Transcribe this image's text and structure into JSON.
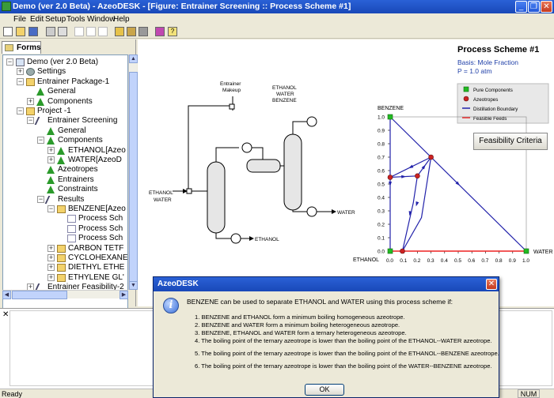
{
  "window": {
    "title": "Demo (ver 2.0 Beta) - AzeoDESK - [Figure: Entrainer Screening :: Process Scheme #1]",
    "minimize": "_",
    "restore": "❐",
    "close": "✕"
  },
  "menu": [
    "File",
    "Edit",
    "Setup",
    "Tools",
    "Window",
    "Help"
  ],
  "left_pane": {
    "tab_label": "Forms",
    "tree": [
      {
        "label": "Demo (ver 2.0 Beta)",
        "icon": "project-icon",
        "level": 0,
        "expander": "−"
      },
      {
        "label": "Settings",
        "icon": "settings-icon",
        "level": 1,
        "expander": "+"
      },
      {
        "label": "Entrainer Package-1",
        "icon": "folder-icon",
        "level": 1,
        "expander": "−"
      },
      {
        "label": "General",
        "icon": "triangle-icon",
        "level": 2,
        "expander": ""
      },
      {
        "label": "Components",
        "icon": "triangle-icon",
        "level": 2,
        "expander": "+"
      },
      {
        "label": "Project -1",
        "icon": "folder-icon",
        "level": 1,
        "expander": "−"
      },
      {
        "label": "Entrainer Screening",
        "icon": "screening-icon",
        "level": 2,
        "expander": "−"
      },
      {
        "label": "General",
        "icon": "triangle-icon",
        "level": 3,
        "expander": ""
      },
      {
        "label": "Components",
        "icon": "triangle-icon",
        "level": 3,
        "expander": "−"
      },
      {
        "label": "ETHANOL[Azeo",
        "icon": "triangle-icon",
        "level": 4,
        "expander": "+"
      },
      {
        "label": "WATER[AzeoD",
        "icon": "triangle-icon",
        "level": 4,
        "expander": "+"
      },
      {
        "label": "Azeotropes",
        "icon": "triangle-icon",
        "level": 3,
        "expander": ""
      },
      {
        "label": "Entrainers",
        "icon": "triangle-icon",
        "level": 3,
        "expander": ""
      },
      {
        "label": "Constraints",
        "icon": "triangle-icon",
        "level": 3,
        "expander": ""
      },
      {
        "label": "Results",
        "icon": "screening-icon",
        "level": 3,
        "expander": "−"
      },
      {
        "label": "BENZENE[Azeo",
        "icon": "folder-icon",
        "level": 4,
        "expander": "−"
      },
      {
        "label": "Process Sch",
        "icon": "document-icon",
        "level": 5,
        "expander": ""
      },
      {
        "label": "Process Sch",
        "icon": "document-icon",
        "level": 5,
        "expander": ""
      },
      {
        "label": "Process Sch",
        "icon": "document-icon",
        "level": 5,
        "expander": ""
      },
      {
        "label": "CARBON TETF",
        "icon": "folder-icon",
        "level": 4,
        "expander": "+"
      },
      {
        "label": "CYCLOHEXANE",
        "icon": "folder-icon",
        "level": 4,
        "expander": "+"
      },
      {
        "label": "DIETHYL ETHE",
        "icon": "folder-icon",
        "level": 4,
        "expander": "+"
      },
      {
        "label": "ETHYLENE GL'",
        "icon": "folder-icon",
        "level": 4,
        "expander": "+"
      },
      {
        "label": "Entrainer Feasibility-2",
        "icon": "screening-icon",
        "level": 2,
        "expander": "+"
      }
    ]
  },
  "scheme": {
    "title": "Process Scheme #1",
    "basis": "Basis: Mole Fraction",
    "pressure": "P = 1.0 atm",
    "makeup_label_1": "Entrainer",
    "makeup_label_2": "Makeup",
    "top_label_1": "ETHANOL",
    "top_label_2": "WATER",
    "top_label_3": "BENZENE",
    "feed_label_1": "ETHANOL",
    "feed_label_2": "WATER",
    "water_out": "WATER",
    "ethanol_out": "ETHANOL",
    "feasibility_button": "Feasibility Criteria"
  },
  "legend": {
    "items": [
      {
        "label": "Pure Components",
        "color": "#22bb22"
      },
      {
        "label": "Azeotropes",
        "color": "#cc2222"
      },
      {
        "label": "Distillation Boundary",
        "color": "#2222aa"
      },
      {
        "label": "Feasible Feeds",
        "color": "#ee2222"
      }
    ]
  },
  "chart_data": {
    "type": "line",
    "subtype": "ternary-residue-curve-map",
    "corners": {
      "top": "BENZENE",
      "left": "ETHANOL",
      "right": "WATER"
    },
    "x_ticks": [
      "0.0",
      "0.1",
      "0.2",
      "0.3",
      "0.4",
      "0.5",
      "0.6",
      "0.7",
      "0.8",
      "0.9",
      "1.0"
    ],
    "y_ticks": [
      "0.0",
      "0.1",
      "0.2",
      "0.3",
      "0.4",
      "0.5",
      "0.6",
      "0.7",
      "0.8",
      "0.9",
      "1.0"
    ],
    "xlim": [
      0,
      1
    ],
    "ylim": [
      0,
      1
    ],
    "pure_components": [
      {
        "x": 0.0,
        "y": 1.0
      },
      {
        "x": 0.0,
        "y": 0.0
      },
      {
        "x": 1.0,
        "y": 0.0
      }
    ],
    "azeotropes": [
      {
        "x": 0.0,
        "y": 0.55
      },
      {
        "x": 0.09,
        "y": 0.0
      },
      {
        "x": 0.2,
        "y": 0.56
      },
      {
        "x": 0.3,
        "y": 0.7
      }
    ],
    "boundaries": [
      [
        {
          "x": 0.0,
          "y": 1.0
        },
        {
          "x": 1.0,
          "y": 0.0
        }
      ],
      [
        {
          "x": 0.0,
          "y": 1.0
        },
        {
          "x": 0.0,
          "y": 0.0
        }
      ],
      [
        {
          "x": 0.0,
          "y": 0.55
        },
        {
          "x": 0.2,
          "y": 0.56
        }
      ],
      [
        {
          "x": 0.2,
          "y": 0.56
        },
        {
          "x": 0.3,
          "y": 0.7
        }
      ],
      [
        {
          "x": 0.3,
          "y": 0.7
        },
        {
          "x": 0.0,
          "y": 0.55
        }
      ],
      [
        {
          "x": 0.3,
          "y": 0.7
        },
        {
          "x": 0.23,
          "y": 0.25
        },
        {
          "x": 0.09,
          "y": 0.0
        }
      ],
      [
        {
          "x": 0.2,
          "y": 0.56
        },
        {
          "x": 0.17,
          "y": 0.36
        },
        {
          "x": 0.09,
          "y": 0.0
        }
      ]
    ],
    "feasible_feeds": [
      {
        "x": 0.0,
        "y": 0.0
      },
      {
        "x": 1.0,
        "y": 0.0
      }
    ]
  },
  "dialog": {
    "title": "AzeoDESK",
    "intro": "BENZENE can be used to separate ETHANOL and WATER using this process scheme if:",
    "conditions": [
      "1. BENZENE and ETHANOL form a minimum boiling homogeneous azeotrope.",
      "2. BENZENE and WATER form a minimum boiling heterogeneous azeotrope.",
      "3. BENZENE, ETHANOL and WATER form a ternary heterogeneous azeotrope.",
      "4. The boiling point of the ternary azeotrope is lower than the boiling point of the ETHANOL--WATER azeotrope.",
      "5. The boiling point of the ternary azeotrope is lower than the boiling point of the ETHANOL--BENZENE azeotrope.",
      "6. The boiling point of the ternary azeotrope is lower than the boiling point of the WATER--BENZENE azeotrope."
    ],
    "ok_label": "OK"
  },
  "status": {
    "text": "Ready",
    "num": "NUM"
  }
}
